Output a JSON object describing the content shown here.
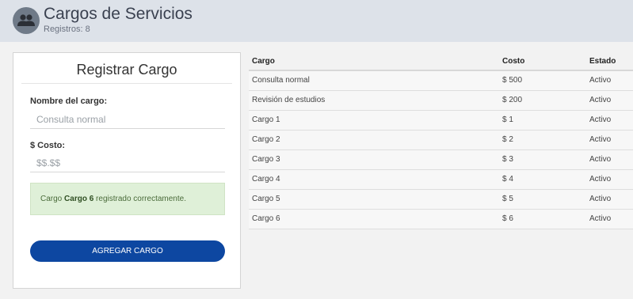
{
  "header": {
    "title": "Cargos de Servicios",
    "subtitle": "Registros: 8",
    "icon": "group-icon"
  },
  "form": {
    "title": "Registrar Cargo",
    "name_label": "Nombre del cargo:",
    "name_placeholder": "Consulta normal",
    "cost_label": "$ Costo:",
    "cost_placeholder": "$$.$$",
    "alert_prefix": "Cargo",
    "alert_bold": "Cargo 6",
    "alert_suffix": "registrado correctamente.",
    "submit_label": "AGREGAR CARGO",
    "button_color": "#0d47a1",
    "alert_color": "#dff0d8"
  },
  "table": {
    "columns": [
      "Cargo",
      "Costo",
      "Estado"
    ],
    "rows": [
      [
        "Consulta normal",
        "$ 500",
        "Activo"
      ],
      [
        "Revisión de estudios",
        "$ 200",
        "Activo"
      ],
      [
        "Cargo 1",
        "$ 1",
        "Activo"
      ],
      [
        "Cargo 2",
        "$ 2",
        "Activo"
      ],
      [
        "Cargo 3",
        "$ 3",
        "Activo"
      ],
      [
        "Cargo 4",
        "$ 4",
        "Activo"
      ],
      [
        "Cargo 5",
        "$ 5",
        "Activo"
      ],
      [
        "Cargo 6",
        "$ 6",
        "Activo"
      ]
    ]
  }
}
